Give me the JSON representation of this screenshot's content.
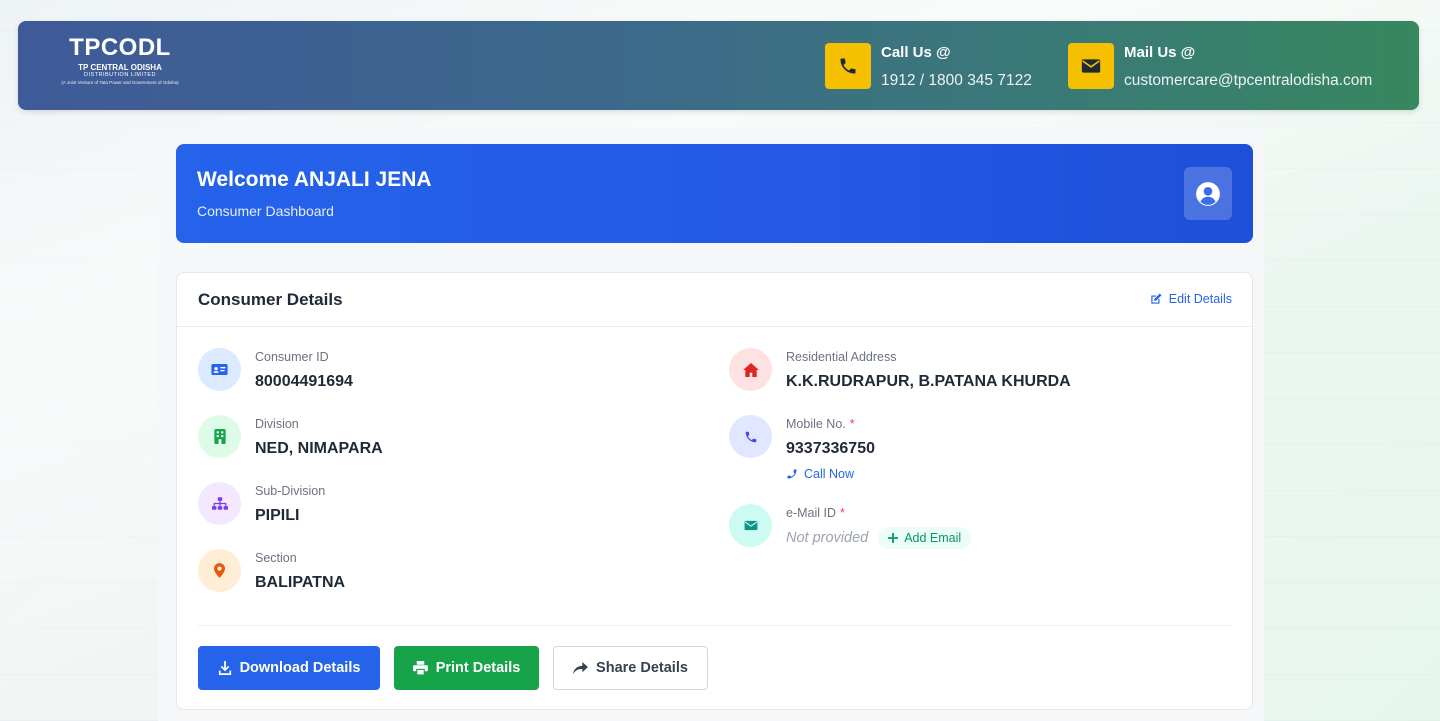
{
  "header": {
    "logo": {
      "name": "TPCODL",
      "line1": "TP CENTRAL ODISHA",
      "line2": "DISTRIBUTION LIMITED",
      "tagline": "(A Joint Venture of Tata Power and Government of Odisha)"
    },
    "call": {
      "title": "Call Us @",
      "value": "1912 / 1800 345 7122",
      "icon": "phone-icon"
    },
    "mail": {
      "title": "Mail Us @",
      "value": "customercare@tpcentralodisha.com",
      "icon": "envelope-icon"
    },
    "icon_bg_color": "#f5c000"
  },
  "welcome": {
    "title": "Welcome ANJALI JENA",
    "subtitle": "Consumer Dashboard",
    "icon": "user-circle-icon",
    "color": "#2563eb"
  },
  "consumer_details": {
    "title": "Consumer Details",
    "edit_label": "Edit Details",
    "left_fields": [
      {
        "label": "Consumer ID",
        "value": "80004491694",
        "icon": "id-card-icon",
        "icon_color": "#2563eb"
      },
      {
        "label": "Division",
        "value": "NED, NIMAPARA",
        "icon": "building-icon",
        "icon_color": "#16a34a"
      },
      {
        "label": "Sub-Division",
        "value": "PIPILI",
        "icon": "sitemap-icon",
        "icon_color": "#7c3aed"
      },
      {
        "label": "Section",
        "value": "BALIPATNA",
        "icon": "map-pin-icon",
        "icon_color": "#ea580c"
      }
    ],
    "address": {
      "label": "Residential Address",
      "value": "K.K.RUDRAPUR, B.PATANA KHURDA",
      "icon": "home-icon",
      "icon_color": "#dc2626"
    },
    "mobile": {
      "label": "Mobile No.",
      "required": "*",
      "value": "9337336750",
      "call_label": "Call Now",
      "icon": "phone-icon",
      "icon_color": "#4f46e5"
    },
    "email": {
      "label": "e-Mail ID",
      "required": "*",
      "value": "Not provided",
      "add_label": "Add Email",
      "icon": "envelope-icon",
      "icon_color": "#0d9488"
    }
  },
  "actions": {
    "download": "Download Details",
    "print": "Print Details",
    "share": "Share Details"
  }
}
